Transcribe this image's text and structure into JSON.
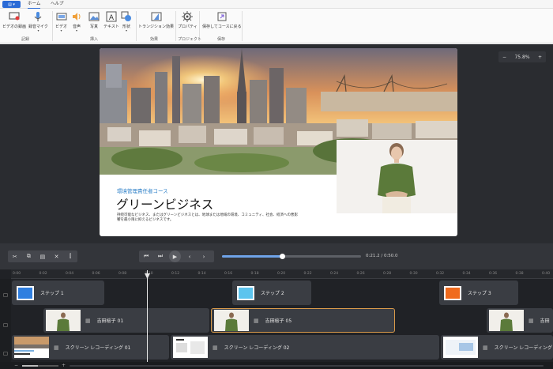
{
  "tabs": {
    "home": "ホーム",
    "help": "ヘルプ"
  },
  "ribbon": {
    "record_video": "ビデオの録画",
    "record_mic": "録音マイク",
    "video": "ビデオ",
    "audio": "音声",
    "photo": "写真",
    "text": "テキスト",
    "shape": "形状",
    "transition": "トランジション効果",
    "properties": "プロパティ",
    "save_return": "保存してコースに戻る",
    "groups": {
      "record": "記録",
      "insert": "挿入",
      "effects": "効果",
      "project": "プロジェクト",
      "save": "保存"
    }
  },
  "zoom": {
    "value": "75.8%",
    "minus": "−",
    "plus": "+"
  },
  "slide": {
    "course": "環境管理責任者コース",
    "title": "グリーンビジネス",
    "desc": "持続可能なビジネス、またはグリーンビジネスとは、地球または地域の環境、コミュニティ、社会、経済への悪影響を最小限に抑えるビジネスです。"
  },
  "player": {
    "time": "0:21.2 / 0:50.0",
    "progress": 0.43
  },
  "ruler": [
    "0:00",
    "0:02",
    "0:04",
    "0:06",
    "0:08",
    "0:10",
    "0:12",
    "0:14",
    "0:16",
    "0:18",
    "0:20",
    "0:22",
    "0:24",
    "0:26",
    "0:28",
    "0:30",
    "0:32",
    "0:34",
    "0:36",
    "0:38",
    "0:40"
  ],
  "tracks": {
    "step1": "ステップ 1",
    "step2": "ステップ 2",
    "step3": "ステップ 3",
    "clip1": "吉田桜子 01",
    "clip5": "吉田桜子 05",
    "clip6": "吉田",
    "screen1": "スクリーン レコーディング 01",
    "screen2": "スクリーン レコーディング 02",
    "screen3": "スクリーン レコーディング"
  },
  "colors": {
    "step1": "#2f7fe0",
    "step2": "#5cc4ee",
    "step3": "#f06a1c",
    "accent": "#2b6bd6"
  }
}
